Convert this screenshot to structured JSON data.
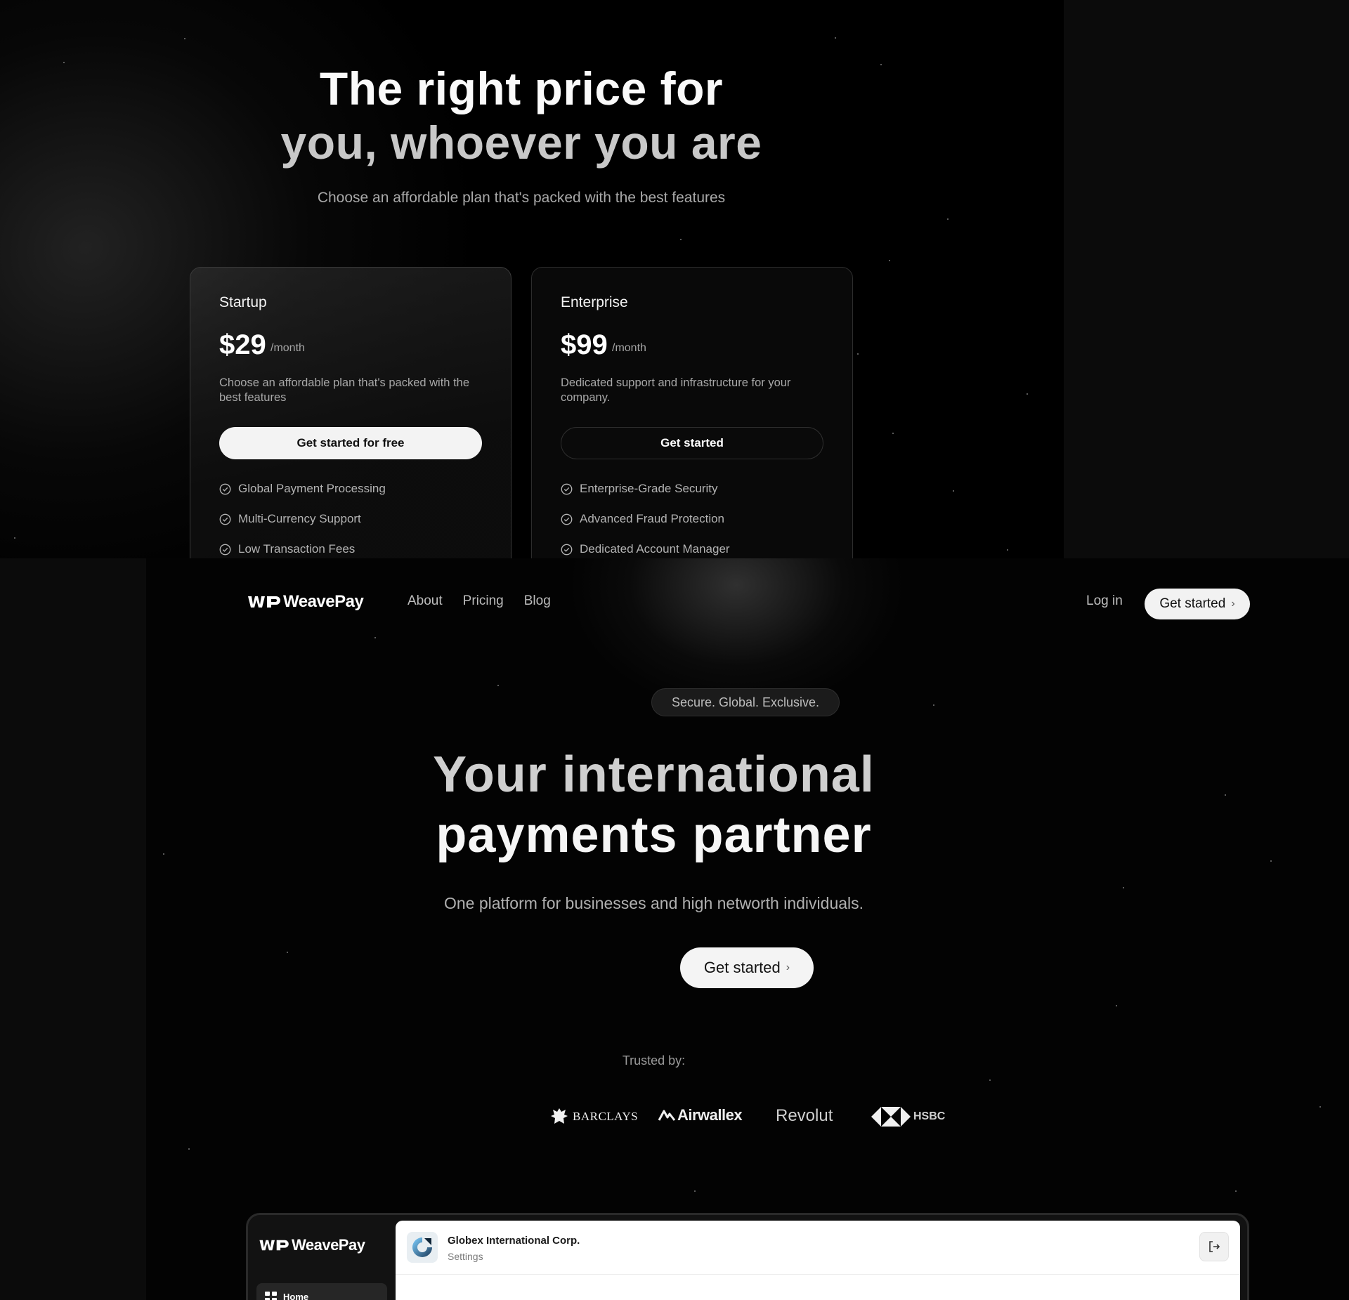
{
  "pricing": {
    "title_line1": "The right price for",
    "title_line2": "you, whoever you are",
    "subtitle": "Choose an affordable plan that's packed with the best features",
    "plans": [
      {
        "name": "Startup",
        "price": "$29",
        "period": "/month",
        "description": "Choose an affordable plan that's packed with the best features",
        "cta": "Get started for free",
        "features": [
          "Global Payment Processing",
          "Multi-Currency Support",
          "Low Transaction Fees"
        ]
      },
      {
        "name": "Enterprise",
        "price": "$99",
        "period": "/month",
        "description": "Dedicated support and infrastructure for your company.",
        "cta": "Get started",
        "features": [
          "Enterprise-Grade Security",
          "Advanced Fraud Protection",
          "Dedicated Account Manager"
        ]
      }
    ]
  },
  "nav": {
    "brand": "WeavePay",
    "links": [
      "About",
      "Pricing",
      "Blog"
    ],
    "login": "Log in",
    "cta": "Get started"
  },
  "hero": {
    "badge": "Secure. Global. Exclusive.",
    "title_line1": "Your international",
    "title_line2": "payments partner",
    "subtitle": "One platform for businesses and high networth individuals.",
    "cta": "Get started",
    "trusted_label": "Trusted by:",
    "brands": [
      "BARCLAYS",
      "Airwallex",
      "Revolut",
      "HSBC"
    ]
  },
  "dashboard": {
    "brand": "WeavePay",
    "nav_home": "Home",
    "org_name": "Globex International Corp.",
    "section": "Settings"
  },
  "colors": {
    "background": "#000000",
    "button_light": "#f3f3f3",
    "text_muted": "#a9a9a9"
  },
  "icons": [
    "check-circle-icon",
    "chevron-right-icon",
    "logout-icon",
    "home-grid-icon",
    "weavepay-logo-icon",
    "company-logo-icon"
  ]
}
